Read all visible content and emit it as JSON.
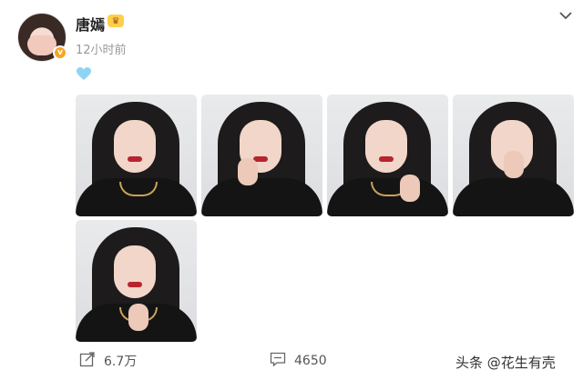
{
  "post": {
    "author": "唐嫣",
    "time": "12小时前",
    "emoji": "light-blue-heart",
    "photos": [
      {
        "name": "photo-1",
        "has_hand": false
      },
      {
        "name": "photo-2",
        "has_hand": true
      },
      {
        "name": "photo-3",
        "has_hand": true
      },
      {
        "name": "photo-4",
        "has_hand": true
      },
      {
        "name": "photo-5",
        "has_hand": true
      }
    ]
  },
  "actions": {
    "share_count": "6.7万",
    "comment_count": "4650"
  },
  "watermark": "头条 @花生有壳",
  "colors": {
    "accent_blue": "#8fd3f4",
    "verified": "#f5a623",
    "muted": "#999999"
  }
}
